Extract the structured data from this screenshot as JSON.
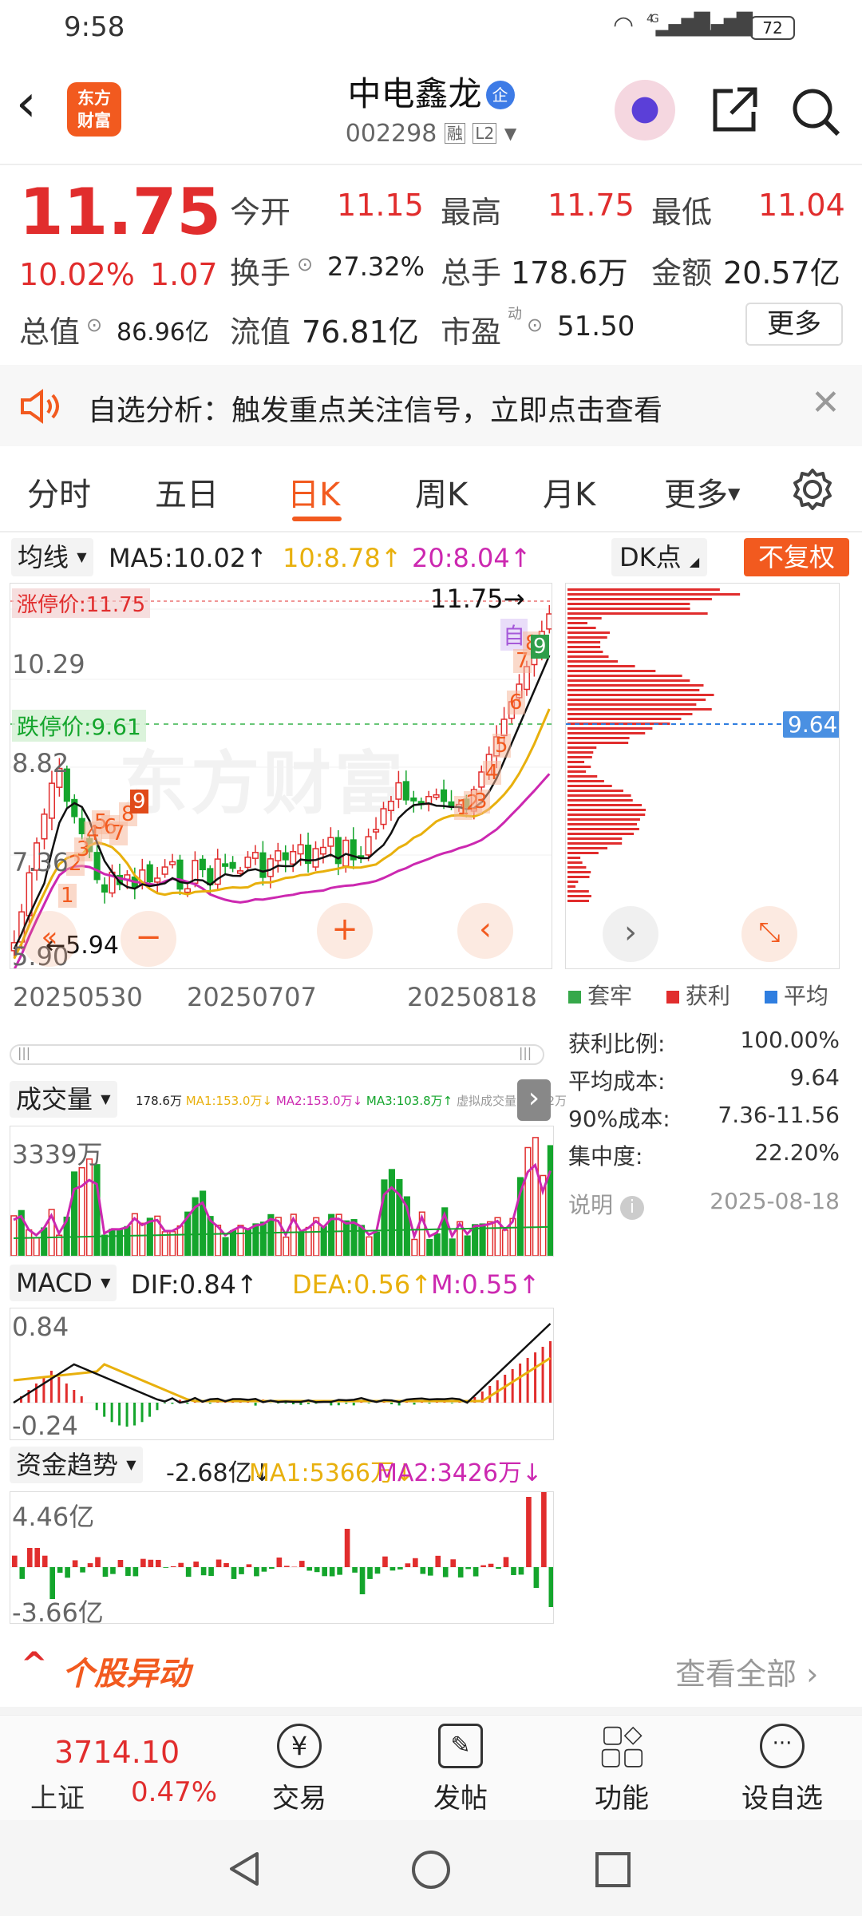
{
  "status_bar": {
    "time": "9:58",
    "signal": "4G",
    "battery": "72"
  },
  "header": {
    "logo_line1": "东方",
    "logo_line2": "财富",
    "stock_name": "中电鑫龙",
    "badge": "企",
    "code": "002298",
    "tag1": "融",
    "tag2": "L2"
  },
  "quote": {
    "price": "11.75",
    "change_pct": "10.02%",
    "change": "1.07",
    "open_label": "今开",
    "open": "11.15",
    "high_label": "最高",
    "high": "11.75",
    "low_label": "最低",
    "low": "11.04",
    "turnover_label": "换手",
    "turnover": "27.32%",
    "volume_label": "总手",
    "volume": "178.6万",
    "amount_label": "金额",
    "amount": "20.57亿",
    "mcap_label": "总值",
    "mcap": "86.96亿",
    "float_label": "流值",
    "float": "76.81亿",
    "pe_label": "市盈",
    "pe_sup": "动",
    "pe": "51.50",
    "more": "更多"
  },
  "notice": {
    "text": "自选分析：触发重点关注信号，立即点击查看"
  },
  "tabs": [
    {
      "label": "分时"
    },
    {
      "label": "五日"
    },
    {
      "label": "日K"
    },
    {
      "label": "周K"
    },
    {
      "label": "月K"
    },
    {
      "label": "更多"
    }
  ],
  "kline": {
    "ma_selector": "均线",
    "ma5": "MA5:10.02↑",
    "ma10": "10:8.78↑",
    "ma20": "20:8.04↑",
    "dk": "DK点",
    "fq": "不复权",
    "limit_up": "涨停价:11.75",
    "limit_down": "跌停价:9.61",
    "y1": "10.29",
    "y2": "8.82",
    "y3": "7.36",
    "y4": "5.90",
    "last_price": "11.75",
    "low_mark": "5.94",
    "marker_zi": "自",
    "watermark": "东方财富",
    "dates": [
      "20250530",
      "20250707",
      "20250818"
    ],
    "markers_left": [
      "1",
      "2",
      "3",
      "4",
      "5",
      "6",
      "7",
      "8",
      "9"
    ],
    "markers_right": [
      "1",
      "2",
      "3",
      "4",
      "5",
      "6",
      "7",
      "8",
      "9"
    ]
  },
  "chips": {
    "price_tag": "9.64",
    "legend": [
      "套牢",
      "获利",
      "平均"
    ],
    "rows": [
      {
        "label": "获利比例:",
        "value": "100.00%"
      },
      {
        "label": "平均成本:",
        "value": "9.64"
      },
      {
        "label": "90%成本:",
        "value": "7.36-11.56"
      },
      {
        "label": "集中度:",
        "value": "22.20%"
      }
    ],
    "note_label": "说明",
    "date": "2025-08-18"
  },
  "volume": {
    "selector": "成交量",
    "v": "178.6万",
    "ma1": "MA1:153.0万↓",
    "ma2": "MA2:153.0万↓",
    "ma3": "MA3:103.8万↑",
    "virtual": "虚拟成交量:191.2万",
    "ymax": "3339万"
  },
  "macd": {
    "selector": "MACD",
    "dif": "DIF:0.84↑",
    "dea": "DEA:0.56↑",
    "m": "M:0.55↑",
    "ymax": "0.84",
    "ymin": "-0.24"
  },
  "fund": {
    "selector": "资金趋势",
    "v": "-2.68亿↓",
    "ma1": "MA1:5366万↓",
    "ma2": "MA2:3426万↓",
    "ymax": "4.46亿",
    "ymin": "-3.66亿"
  },
  "movement": {
    "title": "个股异动",
    "view_all": "查看全部"
  },
  "bottom_nav": {
    "index_value": "3714.10",
    "index_name": "上证",
    "index_pct": "0.47%",
    "items": [
      {
        "label": "交易"
      },
      {
        "label": "发帖"
      },
      {
        "label": "功能"
      },
      {
        "label": "设自选"
      }
    ]
  }
}
